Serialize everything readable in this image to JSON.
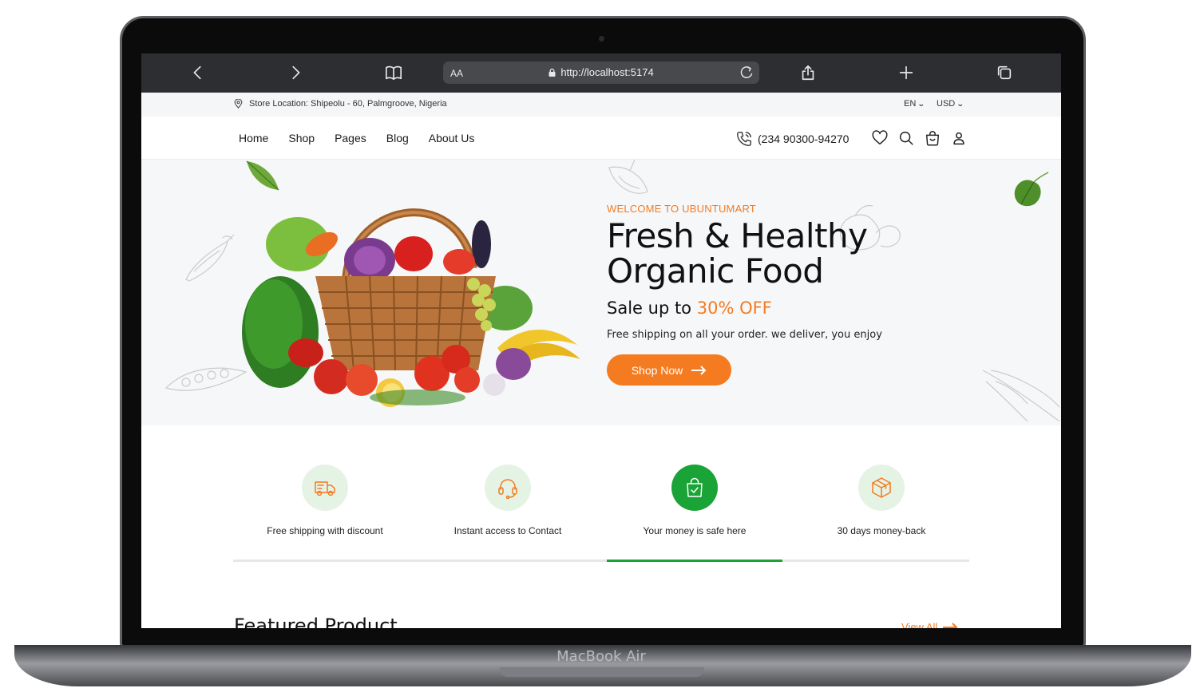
{
  "device": {
    "label": "MacBook Air"
  },
  "browser": {
    "address_prefix": "AA",
    "url": "http://localhost:5174"
  },
  "topbar": {
    "store_location": "Store Location: Shipeolu - 60, Palmgroove, Nigeria",
    "language": "EN",
    "currency": "USD"
  },
  "nav": {
    "links": [
      "Home",
      "Shop",
      "Pages",
      "Blog",
      "About Us"
    ],
    "phone": "(234 90300-94270",
    "icons": [
      "heart-icon",
      "search-icon",
      "bag-icon",
      "user-icon"
    ]
  },
  "hero": {
    "welcome": "WELCOME TO UBUNTUMART",
    "title_line1": "Fresh & Healthy",
    "title_line2": "Organic Food",
    "sale_prefix": "Sale up to",
    "sale_highlight": "30% OFF",
    "subtitle": "Free shipping on all your order. we deliver, you enjoy",
    "button_label": "Shop Now"
  },
  "features": {
    "items": [
      {
        "label": "Free shipping with discount",
        "icon": "truck-icon",
        "active": false
      },
      {
        "label": "Instant access to Contact",
        "icon": "headset-icon",
        "active": false
      },
      {
        "label": "Your money is safe here",
        "icon": "shopping-bag-icon",
        "active": true
      },
      {
        "label": "30 days money-back",
        "icon": "box-icon",
        "active": false
      }
    ],
    "progress_index": 3
  },
  "featured": {
    "title": "Featured Product",
    "view_all": "View All"
  },
  "colors": {
    "accent": "#f47b20",
    "green": "#1aa336",
    "browser_bar": "#2c2e31"
  }
}
